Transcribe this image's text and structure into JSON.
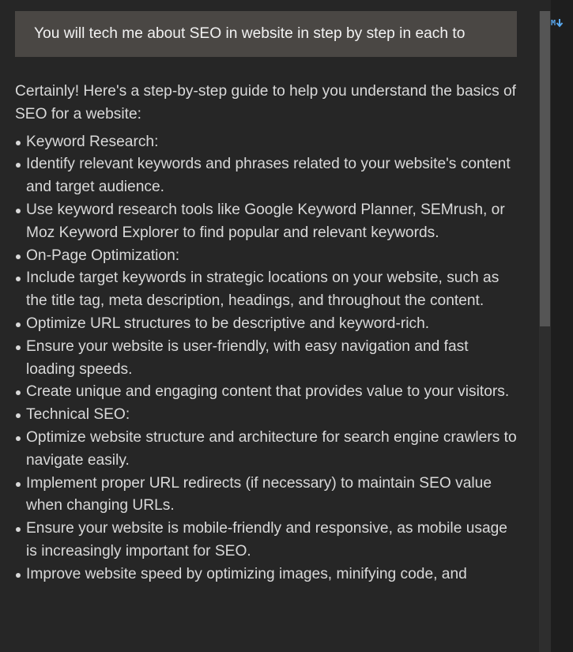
{
  "user_message": {
    "text": "You will tech me about SEO in website in step by step in each to"
  },
  "assistant_message": {
    "intro": "Certainly! Here's a step-by-step guide to help you understand the basics of SEO for a website:",
    "items": [
      "Keyword Research:",
      "Identify relevant keywords and phrases related to your website's content and target audience.",
      "Use keyword research tools like Google Keyword Planner, SEMrush, or Moz Keyword Explorer to find popular and relevant keywords.",
      "On-Page Optimization:",
      "Include target keywords in strategic locations on your website, such as the title tag, meta description, headings, and throughout the content.",
      "Optimize URL structures to be descriptive and keyword-rich.",
      "Ensure your website is user-friendly, with easy navigation and fast loading speeds.",
      "Create unique and engaging content that provides value to your visitors.",
      "Technical SEO:",
      "Optimize website structure and architecture for search engine crawlers to navigate easily.",
      "Implement proper URL redirects (if necessary) to maintain SEO value when changing URLs.",
      "Ensure your website is mobile-friendly and responsive, as mobile usage is increasingly important for SEO.",
      "Improve website speed by optimizing images, minifying code, and"
    ]
  },
  "toolbar": {
    "markdown_badge_label": "M",
    "markdown_badge_icon": "markdown-download-arrow-icon",
    "accent_color": "#5aa9f0"
  },
  "colors": {
    "background": "#262626",
    "user_bubble": "#4a4744",
    "text": "#d9d9d9",
    "scroll_thumb": "#555555"
  }
}
